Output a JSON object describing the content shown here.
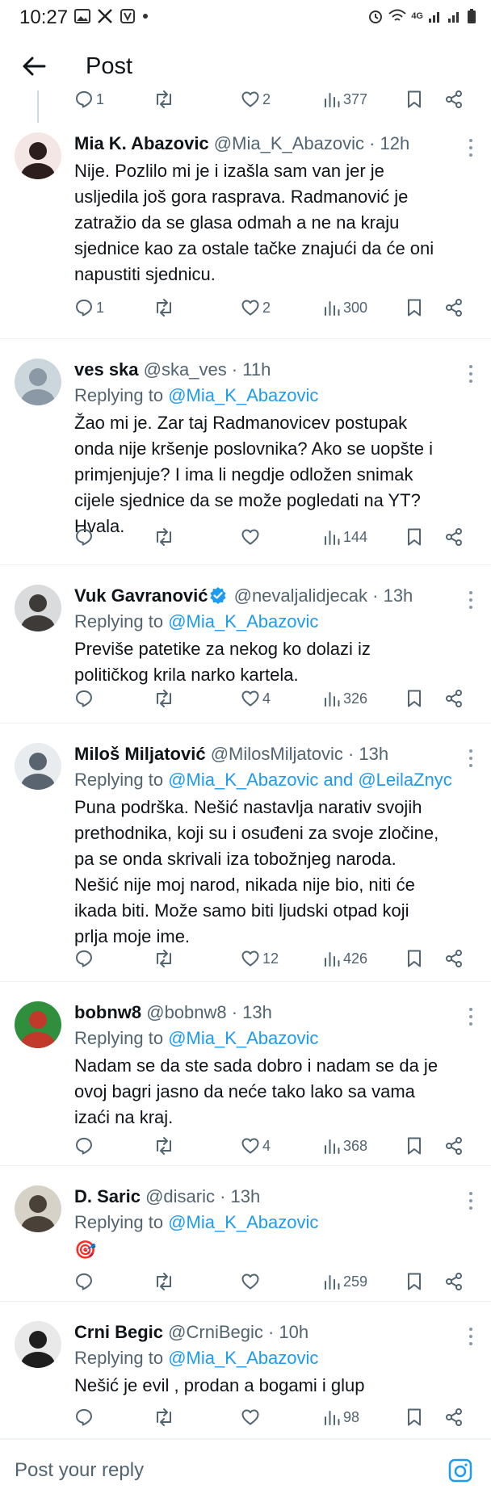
{
  "status_bar": {
    "time": "10:27",
    "left_icons": [
      "image-icon",
      "x-logo-icon",
      "shield-icon",
      "dot-icon"
    ],
    "right_icons": [
      "alarm-icon",
      "wifi-icon",
      "4g-icon",
      "signal-icon",
      "signal-icon",
      "battery-icon"
    ],
    "network": "4G"
  },
  "topbar": {
    "title": "Post"
  },
  "first_actions": {
    "reply_count": "1",
    "like_count": "2",
    "view_count": "377"
  },
  "tweets": [
    {
      "name": "Mia K. Abazovic",
      "handle": "@Mia_K_Abazovic · 12h",
      "verified": false,
      "replying_to": "",
      "text_lines": [
        "Nije. Pozlilo mi je i izašla sam van jer je",
        "usljedila još gora rasprava. Radmanović je",
        "zatražio da se glasa odmah a ne na kraju",
        "sjednice kao za ostale tačke znajući da će oni",
        "napustiti sjednicu."
      ],
      "reply_count": "1",
      "retweet_count": "",
      "like_count": "2",
      "view_count": "300",
      "avatar_colors": [
        "#f4e6e4",
        "#2b1e1d"
      ]
    },
    {
      "name": "ves ska",
      "handle": "@ska_ves · 11h",
      "verified": false,
      "replying_prefix": "Replying to ",
      "replying_to": "@Mia_K_Abazovic",
      "text_lines": [
        "Žao mi je. Zar taj Radmanovicev postupak",
        "onda nije kršenje poslovnika? Ako se uopšte i",
        "primjenjuje? I ima li negdje odložen snimak",
        "cijele sjednice da se može pogledati na YT?",
        "Hvala."
      ],
      "reply_count": "",
      "retweet_count": "",
      "like_count": "",
      "view_count": "144",
      "avatar_colors": [
        "#ccd6dd",
        "#8b98a5"
      ]
    },
    {
      "name": "Vuk Gavranović",
      "handle": "@nevaljalidjecak · 13h",
      "verified": true,
      "replying_prefix": "Replying to ",
      "replying_to": "@Mia_K_Abazovic",
      "text_lines": [
        "Previše patetike za nekog ko dolazi iz",
        "političkog krila narko kartela."
      ],
      "reply_count": "",
      "retweet_count": "",
      "like_count": "4",
      "view_count": "326",
      "avatar_colors": [
        "#d9dbdc",
        "#3d3a37"
      ]
    },
    {
      "name": "Miloš Miljatović",
      "handle": "@MilosMiljatovic · 13h",
      "verified": false,
      "replying_prefix": "Replying to ",
      "replying_to": "@Mia_K_Abazovic and @LeilaZnyc",
      "text_lines": [
        "Puna podrška. Nešić nastavlja narativ svojih",
        "prethodnika, koji su i osuđeni za svoje zločine,",
        "pa se onda skrivali iza tobožnjeg naroda.",
        "Nešić nije moj narod, nikada nije bio, niti će",
        "ikada biti. Može samo biti ljudski otpad koji",
        "prlja moje ime."
      ],
      "reply_count": "",
      "retweet_count": "",
      "like_count": "12",
      "view_count": "426",
      "avatar_colors": [
        "#e8ecef",
        "#5a6470"
      ]
    },
    {
      "name": "bobnw8",
      "handle": "@bobnw8 · 13h",
      "verified": false,
      "replying_prefix": "Replying to ",
      "replying_to": "@Mia_K_Abazovic",
      "text_lines": [
        "Nadam se da ste sada dobro i nadam se da je",
        "ovoj bagri jasno da neće tako lako sa vama",
        "izaći na kraj."
      ],
      "reply_count": "",
      "retweet_count": "",
      "like_count": "4",
      "view_count": "368",
      "avatar_colors": [
        "#2f8f3c",
        "#c0392b"
      ]
    },
    {
      "name": "D. Saric",
      "handle": "@disaric · 13h",
      "verified": false,
      "replying_prefix": "Replying to ",
      "replying_to": "@Mia_K_Abazovic",
      "text_lines": [
        "🎯"
      ],
      "reply_count": "",
      "retweet_count": "",
      "like_count": "",
      "view_count": "259",
      "avatar_colors": [
        "#d7d2c8",
        "#4a4238"
      ]
    },
    {
      "name": "Crni Begic",
      "handle": "@CrniBegic · 10h",
      "verified": false,
      "replying_prefix": "Replying to ",
      "replying_to": "@Mia_K_Abazovic",
      "text_lines": [
        "Nešić je evil , prodan a bogami i glup"
      ],
      "reply_count": "",
      "retweet_count": "",
      "like_count": "",
      "view_count": "98",
      "avatar_colors": [
        "#e9e9e9",
        "#1e1e1e"
      ]
    }
  ],
  "reply_bar": {
    "placeholder": "Post your reply"
  },
  "colors": {
    "accent": "#1d9bf0",
    "text": "#0f1419",
    "muted": "#536471",
    "divider": "#eff3f4"
  }
}
